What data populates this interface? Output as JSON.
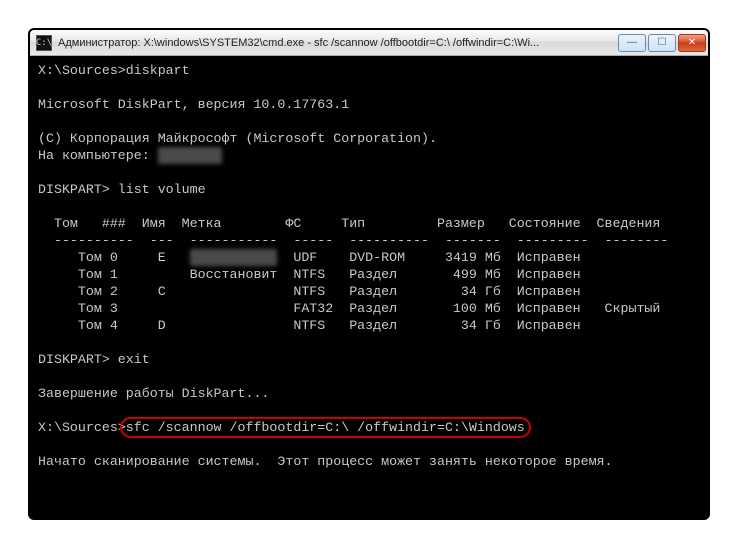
{
  "window": {
    "title": "Администратор: X:\\windows\\SYSTEM32\\cmd.exe - sfc  /scannow /offbootdir=C:\\ /offwindir=C:\\Wi...",
    "icon_label": "C:\\",
    "min": "—",
    "max": "☐",
    "close": "✕"
  },
  "lines": {
    "l1_prompt": "X:\\Sources>",
    "l1_cmd": "diskpart",
    "l2": "Microsoft DiskPart, версия 10.0.17763.1",
    "l3": "(C) Корпорация Майкрософт (Microsoft Corporation).",
    "l4_a": "На компьютере: ",
    "l4_blur": "XXXXXXXX",
    "l5_prompt": "DISKPART> ",
    "l5_cmd": "list volume",
    "hdr": "  Том   ###  Имя  Метка        ФС     Тип         Размер   Состояние  Сведения",
    "hr": "  ----------  ---  -----------  -----  ----------  -------  ---------  --------",
    "r0a": "     Том 0     E   ",
    "r0blur": "XXXXXXXXXXX",
    "r0b": "  UDF    DVD-ROM     3419 Мб  Исправен",
    "r1": "     Том 1         Восстановит  NTFS   Раздел       499 Мб  Исправен",
    "r2": "     Том 2     C                NTFS   Раздел        34 Гб  Исправен",
    "r3": "     Том 3                      FAT32  Раздел       100 Мб  Исправен   Скрытый",
    "r4": "     Том 4     D                NTFS   Раздел        34 Гб  Исправен",
    "l6_prompt": "DISKPART> ",
    "l6_cmd": "exit",
    "l7": "Завершение работы DiskPart...",
    "l8_prompt": "X:\\Sources>",
    "l8_cmd": "sfc /scannow /offbootdir=C:\\ /offwindir=C:\\Windows",
    "l9": "Начато сканирование системы.  Этот процесс может занять некоторое время."
  }
}
